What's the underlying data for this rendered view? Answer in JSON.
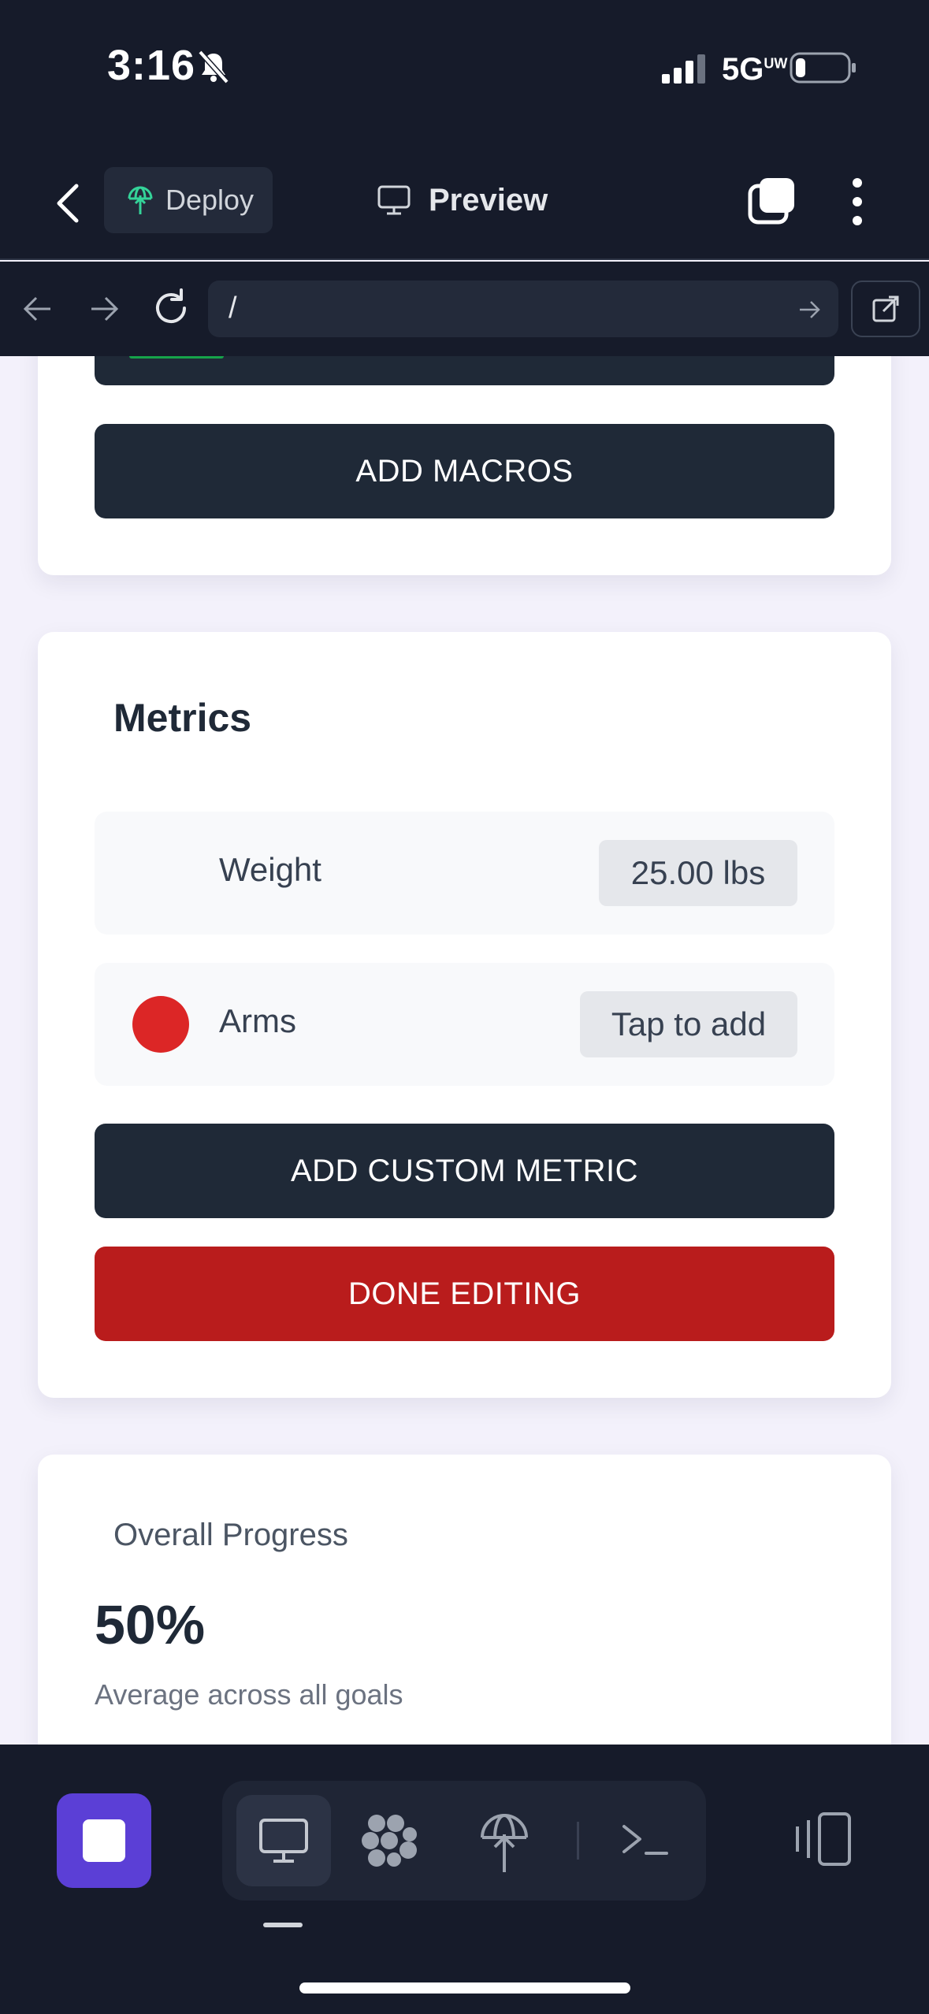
{
  "status_bar": {
    "time": "3:16",
    "network": "5G",
    "network_suffix": "UW"
  },
  "toolbar": {
    "deploy_label": "Deploy",
    "preview_label": "Preview"
  },
  "browser": {
    "url": "/"
  },
  "macros_card": {
    "add_macros_label": "ADD MACROS"
  },
  "metrics_card": {
    "title": "Metrics",
    "rows": [
      {
        "name": "Weight",
        "value": "25.00 lbs"
      },
      {
        "name": "Arms",
        "value": "Tap to add",
        "dot_color": "#dc2626"
      }
    ],
    "add_metric_label": "ADD CUSTOM METRIC",
    "done_label": "DONE EDITING"
  },
  "progress_card": {
    "label": "Overall Progress",
    "value": "50%",
    "subtitle": "Average across all goals"
  },
  "colors": {
    "chrome": "#161b2a",
    "dark_button": "#1f2937",
    "danger_button": "#b91c1c",
    "accent": "#5b3fd6"
  }
}
